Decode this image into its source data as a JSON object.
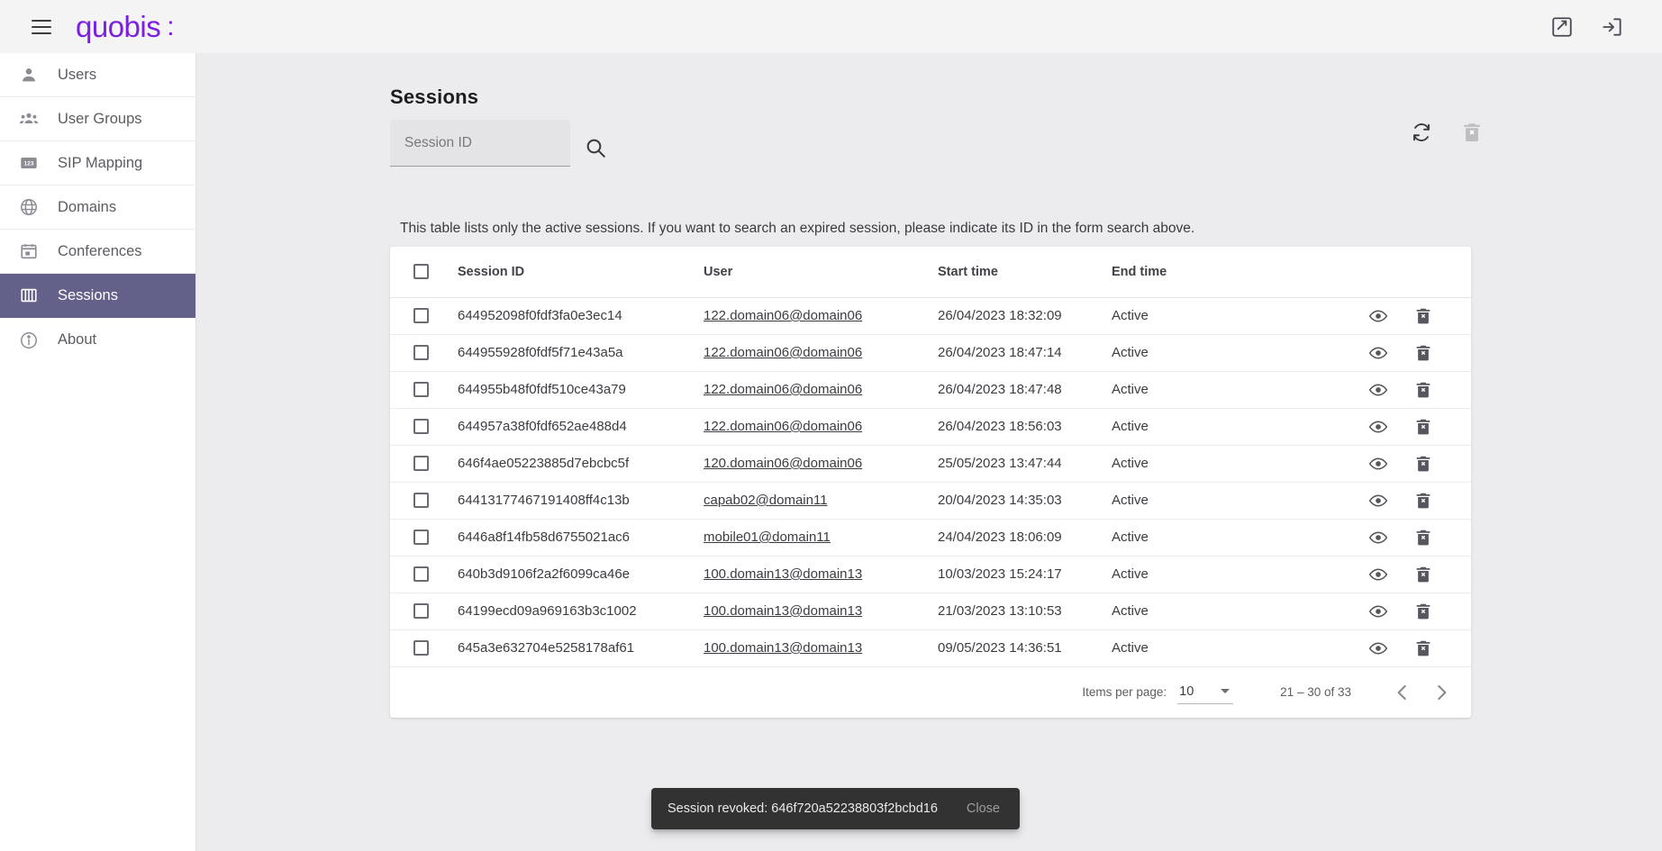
{
  "topbar": {
    "menu_icon": "hamburger-menu-icon",
    "logo_text": "quobis",
    "logo_mark": ":",
    "actions": [
      {
        "name": "feedback-icon",
        "label": ""
      },
      {
        "name": "logout-icon",
        "label": ""
      }
    ]
  },
  "sidebar": {
    "items": [
      {
        "label": "Users",
        "icon": "person-icon",
        "active": false
      },
      {
        "label": "User Groups",
        "icon": "people-group-icon",
        "active": false
      },
      {
        "label": "SIP Mapping",
        "icon": "numbers-123-icon",
        "active": false
      },
      {
        "label": "Domains",
        "icon": "globe-icon",
        "active": false
      },
      {
        "label": "Conferences",
        "icon": "calendar-icon",
        "active": false
      },
      {
        "label": "Sessions",
        "icon": "sessions-columns-icon",
        "active": true
      },
      {
        "label": "About",
        "icon": "info-circle-icon",
        "active": false
      }
    ]
  },
  "main": {
    "title": "Sessions",
    "search": {
      "value": "",
      "placeholder": "Session ID",
      "button_icon": "search-icon"
    },
    "toolbar": [
      {
        "name": "refresh-button",
        "icon": "refresh-icon",
        "disabled": false
      },
      {
        "name": "delete-selected-button",
        "icon": "delete-forever-icon",
        "disabled": true
      }
    ],
    "note": "This table lists only the active sessions. If you want to search an expired session, please indicate its ID in the form search above.",
    "table": {
      "columns": [
        "Session ID",
        "User",
        "Start time",
        "End time"
      ],
      "rows": [
        {
          "session_id": "644952098f0fdf3fa0e3ec14",
          "user": "122.domain06@domain06",
          "start_time": "26/04/2023 18:32:09",
          "end_time": "Active"
        },
        {
          "session_id": "644955928f0fdf5f71e43a5a",
          "user": "122.domain06@domain06",
          "start_time": "26/04/2023 18:47:14",
          "end_time": "Active"
        },
        {
          "session_id": "644955b48f0fdf510ce43a79",
          "user": "122.domain06@domain06",
          "start_time": "26/04/2023 18:47:48",
          "end_time": "Active"
        },
        {
          "session_id": "644957a38f0fdf652ae488d4",
          "user": "122.domain06@domain06",
          "start_time": "26/04/2023 18:56:03",
          "end_time": "Active"
        },
        {
          "session_id": "646f4ae05223885d7ebcbc5f",
          "user": "120.domain06@domain06",
          "start_time": "25/05/2023 13:47:44",
          "end_time": "Active"
        },
        {
          "session_id": "64413177467191408ff4c13b",
          "user": "capab02@domain11",
          "start_time": "20/04/2023 14:35:03",
          "end_time": "Active"
        },
        {
          "session_id": "6446a8f14fb58d6755021ac6",
          "user": "mobile01@domain11",
          "start_time": "24/04/2023 18:06:09",
          "end_time": "Active"
        },
        {
          "session_id": "640b3d9106f2a2f6099ca46e",
          "user": "100.domain13@domain13",
          "start_time": "10/03/2023 15:24:17",
          "end_time": "Active"
        },
        {
          "session_id": "64199ecd09a969163b3c1002",
          "user": "100.domain13@domain13",
          "start_time": "21/03/2023 13:10:53",
          "end_time": "Active"
        },
        {
          "session_id": "645a3e632704e5258178af61",
          "user": "100.domain13@domain13",
          "start_time": "09/05/2023 14:36:51",
          "end_time": "Active"
        }
      ],
      "row_actions": [
        {
          "name": "view-session-button",
          "icon": "eye-icon"
        },
        {
          "name": "revoke-session-button",
          "icon": "delete-forever-icon"
        }
      ]
    },
    "paginator": {
      "items_per_page_label": "Items per page:",
      "items_per_page_value": "10",
      "range_label": "21 – 30 of 33",
      "prev_icon": "chevron-left-icon",
      "next_icon": "chevron-right-icon"
    }
  },
  "snackbar": {
    "message": "Session revoked: 646f720a52238803f2bcbd16",
    "action_label": "Close"
  },
  "colors": {
    "brand_purple": "#7b1fe0",
    "active_nav": "#63608a",
    "page_bg": "#ececee",
    "snackbar_bg": "#323232"
  }
}
